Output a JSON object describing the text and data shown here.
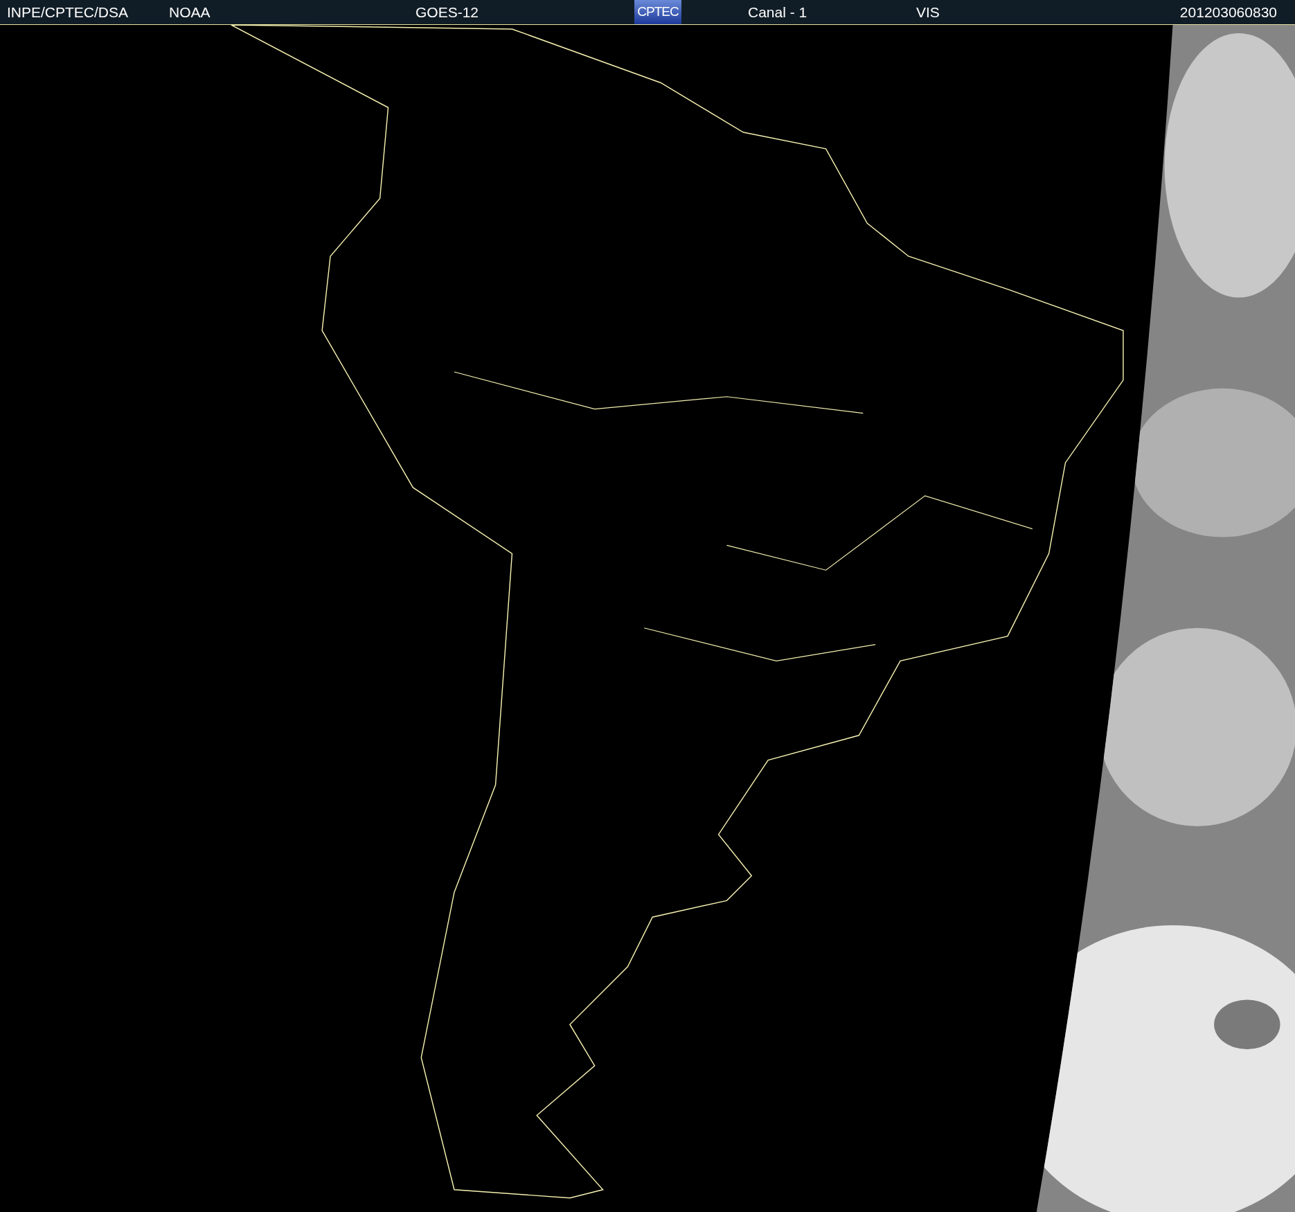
{
  "header": {
    "source": "INPE/CPTEC/DSA",
    "agency": "NOAA",
    "satellite": "GOES-12",
    "logo": "CPTEC",
    "channel": "Canal - 1",
    "band": "VIS",
    "timestamp": "201203060830"
  }
}
